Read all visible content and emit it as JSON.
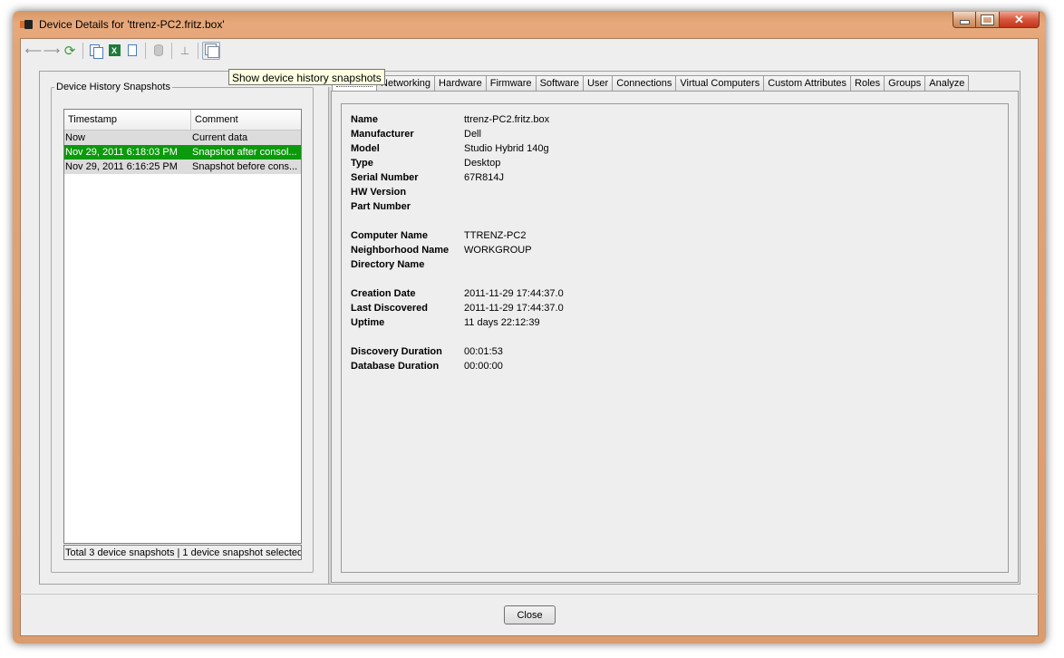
{
  "window": {
    "title": "Device Details for 'ttrenz-PC2.fritz.box'"
  },
  "toolbar": {
    "tooltip": "Show device history snapshots"
  },
  "snapshots": {
    "legend": "Device History Snapshots",
    "columns": [
      "Timestamp",
      "Comment"
    ],
    "rows": [
      {
        "timestamp": "Now",
        "comment": "Current data"
      },
      {
        "timestamp": "Nov 29, 2011 6:18:03 PM",
        "comment": "Snapshot after consol..."
      },
      {
        "timestamp": "Nov 29, 2011 6:16:25 PM",
        "comment": "Snapshot before cons..."
      }
    ],
    "status": "Total 3 device snapshots | 1 device snapshot selected"
  },
  "tabs": [
    "Networking",
    "Hardware",
    "Firmware",
    "Software",
    "User",
    "Connections",
    "Virtual Computers",
    "Custom Attributes",
    "Roles",
    "Groups",
    "Analyze"
  ],
  "details": [
    {
      "label": "Name",
      "value": "ttrenz-PC2.fritz.box"
    },
    {
      "label": "Manufacturer",
      "value": "Dell"
    },
    {
      "label": "Model",
      "value": "Studio Hybrid 140g"
    },
    {
      "label": "Type",
      "value": "Desktop"
    },
    {
      "label": "Serial Number",
      "value": "67R814J"
    },
    {
      "label": "HW Version",
      "value": ""
    },
    {
      "label": "Part Number",
      "value": ""
    },
    {
      "label": "Computer Name",
      "value": "TTRENZ-PC2"
    },
    {
      "label": "Neighborhood Name",
      "value": "WORKGROUP"
    },
    {
      "label": "Directory Name",
      "value": ""
    },
    {
      "label": "Creation Date",
      "value": "2011-11-29 17:44:37.0"
    },
    {
      "label": "Last Discovered",
      "value": "2011-11-29 17:44:37.0"
    },
    {
      "label": "Uptime",
      "value": "11 days 22:12:39"
    },
    {
      "label": "Discovery Duration",
      "value": "00:01:53"
    },
    {
      "label": "Database Duration",
      "value": "00:00:00"
    }
  ],
  "footer": {
    "close_label": "Close"
  },
  "colors": {
    "selection": "#0b9a0b",
    "frame": "#e3a476"
  }
}
